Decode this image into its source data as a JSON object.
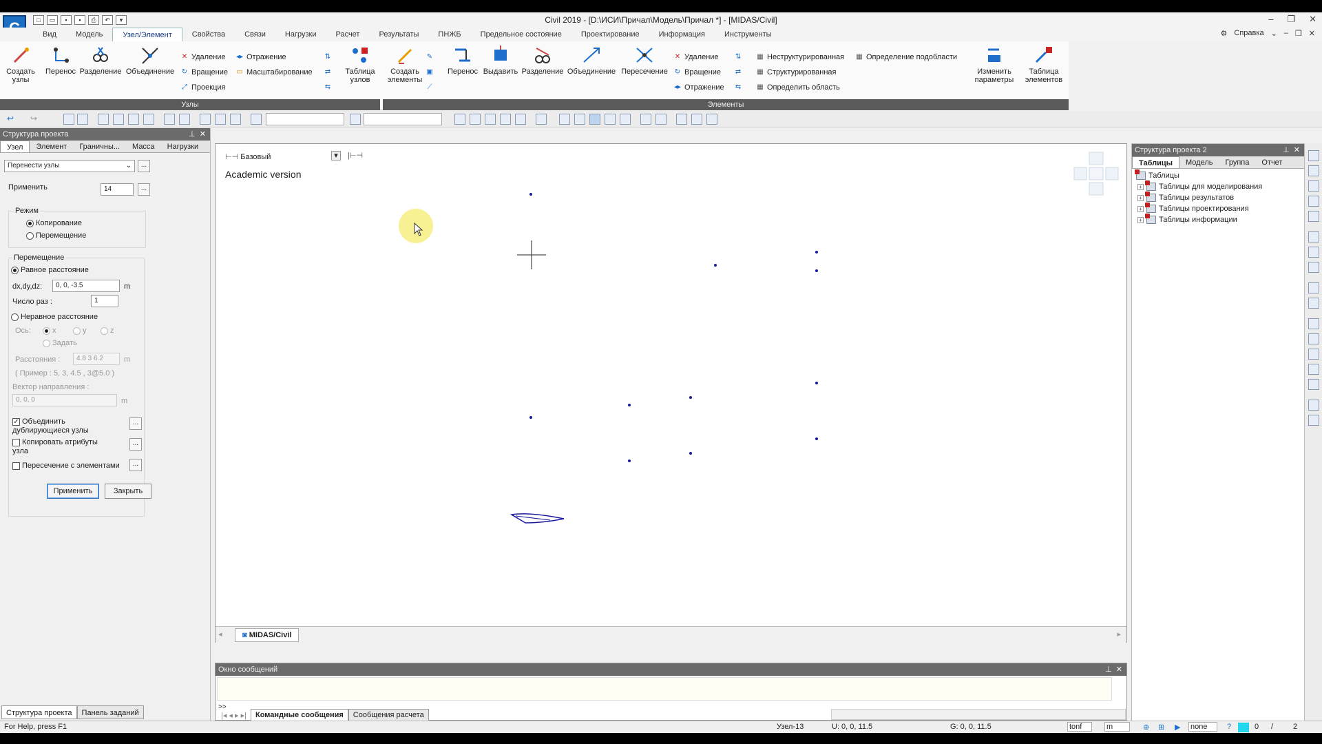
{
  "window": {
    "title": "Civil 2019 - [D:\\ИСИ\\Причал\\Модель\\Причал *] - [MIDAS/Civil]",
    "logo_letter": "C"
  },
  "menu": {
    "tabs": [
      "Вид",
      "Модель",
      "Узел/Элемент",
      "Свойства",
      "Связи",
      "Нагрузки",
      "Расчет",
      "Результаты",
      "ПНЖБ",
      "Предельное состояние",
      "Проектирование",
      "Информация",
      "Инструменты"
    ],
    "help": "Справка"
  },
  "ribbon": {
    "nodes_group": "Узлы",
    "elements_group": "Элементы",
    "create_nodes": "Создать узлы",
    "translate": "Перенос",
    "divide": "Разделение",
    "merge": "Объединение",
    "delete": "Удаление",
    "rotate": "Вращение",
    "projection": "Проекция",
    "mirror": "Отражение",
    "scale": "Масштабирование",
    "node_table": "Таблица узлов",
    "create_elements": "Создать элементы",
    "e_translate": "Перенос",
    "extrude": "Выдавить",
    "e_divide": "Разделение",
    "e_merge": "Объединение",
    "intersect": "Пересечение",
    "e_delete": "Удаление",
    "e_rotate": "Вращение",
    "e_mirror": "Отражение",
    "unstructured": "Неструктурированная",
    "structured": "Структурированная",
    "define_domain": "Определить область",
    "subdomain": "Определение подобласти",
    "change_params": "Изменить параметры",
    "element_table": "Таблица элементов"
  },
  "left_panel": {
    "header": "Структура проекта",
    "tabs": [
      "Узел",
      "Элемент",
      "Граничны...",
      "Масса",
      "Нагрузки"
    ],
    "function_select": "Перенести узлы",
    "apply_label": "Применить",
    "apply_value": "14",
    "mode_label": "Режим",
    "copy": "Копирование",
    "move": "Перемещение",
    "translation_label": "Перемещение",
    "equal_dist": "Равное расстояние",
    "dxdydz_label": "dx,dy,dz:",
    "dxdydz_value": "0, 0, -3.5",
    "unit_m": "m",
    "times_label": "Число раз :",
    "times_value": "1",
    "unequal_dist": "Неравное расстояние",
    "axis_label": "Ось:",
    "axis_x": "x",
    "axis_y": "y",
    "axis_z": "z",
    "axis_set": "Задать",
    "distances_label": "Расстояния :",
    "distances_value": "4.8 3 6.2",
    "example": "( Пример : 5, 3, 4.5 , 3@5.0 )",
    "direction_label": "Вектор направления :",
    "direction_value": "0, 0, 0",
    "merge_dup": "Объединить дублирующиеся узлы",
    "copy_attr": "Копировать атрибуты узла",
    "intersect_elem": "Пересечение с элементами",
    "apply_btn": "Применить",
    "close_btn": "Закрыть",
    "bottom_tabs": [
      "Структура проекта",
      "Панель заданий"
    ]
  },
  "viewport": {
    "view_name": "Базовый",
    "watermark": "Academic version",
    "doc_tab": "MIDAS/Civil"
  },
  "messages": {
    "header": "Окно сообщений",
    "prompt": ">>",
    "tabs": [
      "Командные сообщения",
      "Сообщения расчета"
    ]
  },
  "right_panel": {
    "header": "Структура проекта  2",
    "tabs": [
      "Таблицы",
      "Модель",
      "Группа",
      "Отчет"
    ],
    "tree_root": "Таблицы",
    "tree_items": [
      "Таблицы для моделирования",
      "Таблицы результатов",
      "Таблицы проектирования",
      "Таблицы информации"
    ]
  },
  "status": {
    "help": "For Help, press F1",
    "node": "Узел-13",
    "u": "U: 0, 0, 11.5",
    "g": "G: 0, 0, 11.5",
    "force_unit": "tonf",
    "len_unit": "m",
    "render": "none",
    "value1": "0",
    "value2": "2"
  }
}
